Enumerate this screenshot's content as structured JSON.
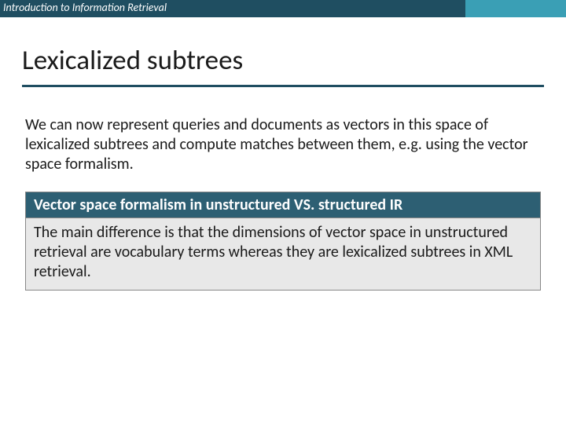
{
  "header": {
    "course_title": "Introduction to Information Retrieval"
  },
  "slide": {
    "title": "Lexicalized subtrees",
    "body_paragraph": "We can now represent queries and documents as vectors in this space of lexicalized subtrees and compute matches between them, e.g. using the vector space formalism.",
    "callout": {
      "heading": "Vector space formalism in unstructured VS. structured IR",
      "body": "The main difference is that the dimensions of vector space in unstructured retrieval are vocabulary terms whereas they are lexicalized subtrees in XML retrieval."
    }
  }
}
